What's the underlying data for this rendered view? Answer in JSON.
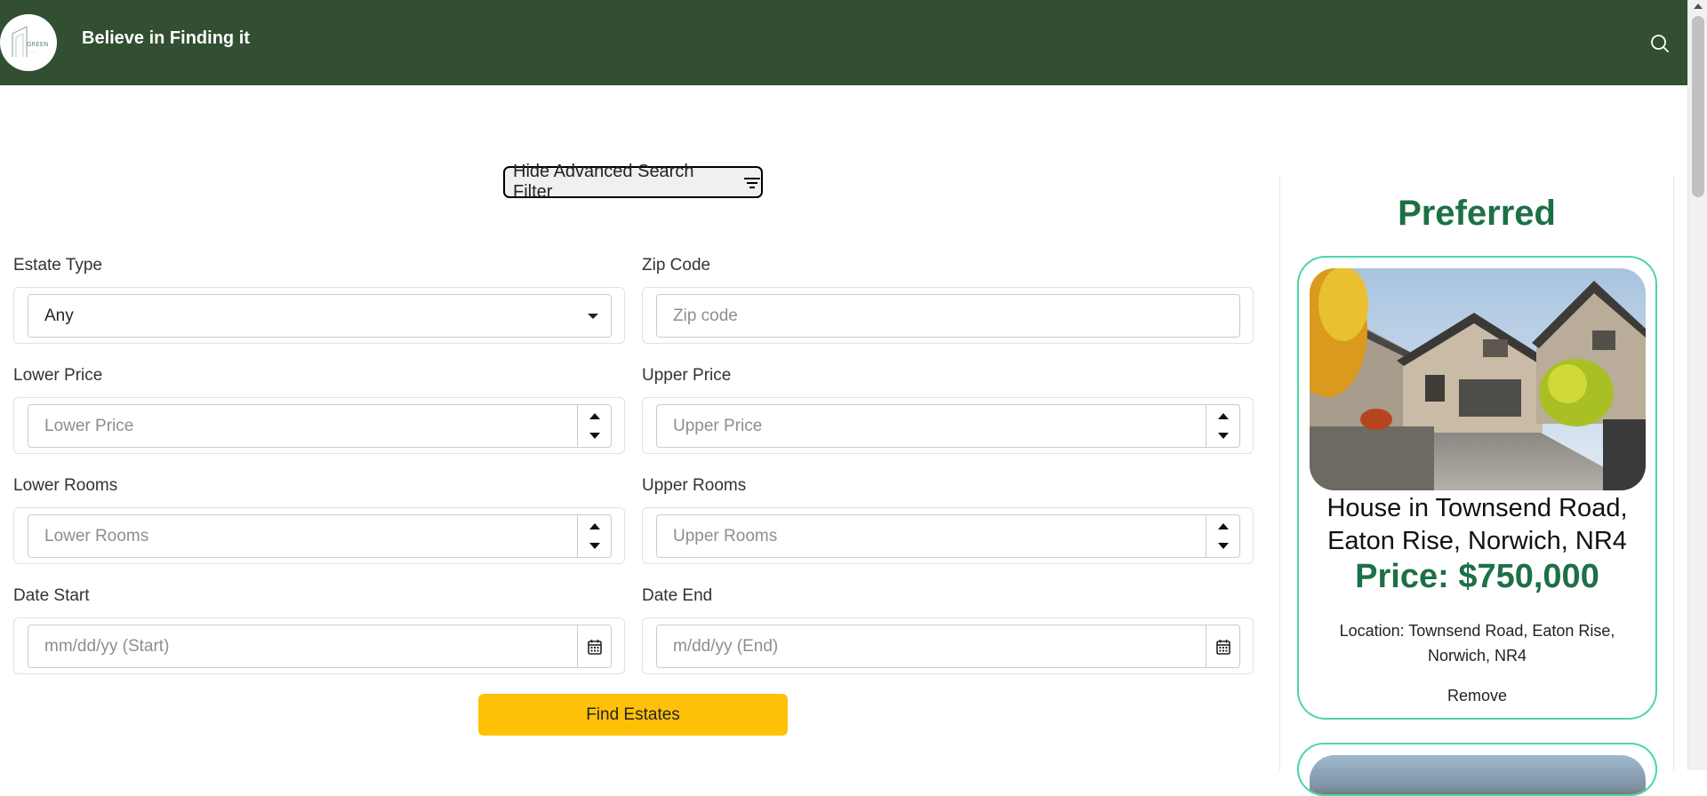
{
  "header": {
    "brand": "Believe in Finding it",
    "logo_text": "GREEN",
    "bg_color": "#324f31",
    "search_icon": "search-icon"
  },
  "filter_toggle": {
    "label": "Hide Advanced Search Filter",
    "icon": "filter-icon"
  },
  "form": {
    "estate_type": {
      "label": "Estate Type",
      "value": "Any"
    },
    "zip_code": {
      "label": "Zip Code",
      "placeholder": "Zip code"
    },
    "lower_price": {
      "label": "Lower Price",
      "placeholder": "Lower Price"
    },
    "upper_price": {
      "label": "Upper Price",
      "placeholder": "Upper Price"
    },
    "lower_rooms": {
      "label": "Lower Rooms",
      "placeholder": "Lower Rooms"
    },
    "upper_rooms": {
      "label": "Upper Rooms",
      "placeholder": "Upper Rooms"
    },
    "date_start": {
      "label": "Date Start",
      "placeholder": "mm/dd/yy (Start)"
    },
    "date_end": {
      "label": "Date End",
      "placeholder": "m/dd/yy (End)"
    },
    "submit_label": "Find Estates",
    "submit_color": "#ffc107"
  },
  "preferred": {
    "title": "Preferred",
    "accent_color": "#1d7046",
    "cards": [
      {
        "title": "House in Townsend Road, Eaton Rise, Norwich, NR4",
        "price": "Price: $750,000",
        "location": "Location: Townsend Road, Eaton Rise, Norwich, NR4",
        "remove_label": "Remove"
      }
    ]
  }
}
